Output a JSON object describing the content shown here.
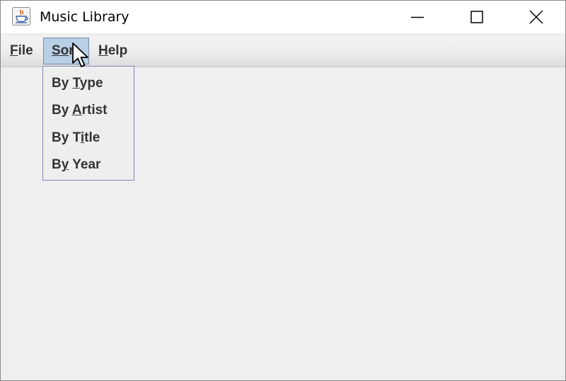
{
  "window": {
    "title": "Music Library",
    "icon": "java-cup-icon"
  },
  "window_controls": {
    "minimize": "minimize-icon",
    "maximize": "maximize-icon",
    "close": "close-icon"
  },
  "menubar": {
    "file": {
      "before": "",
      "mnemonic": "F",
      "after": "ile"
    },
    "sort": {
      "before": "",
      "mnemonic": "So",
      "after": "rt"
    },
    "help": {
      "before": "",
      "mnemonic": "H",
      "after": "elp"
    }
  },
  "sort_menu": {
    "items": [
      {
        "before": "By ",
        "mnemonic": "T",
        "after": "ype"
      },
      {
        "before": "By ",
        "mnemonic": "A",
        "after": "rtist"
      },
      {
        "before": "By T",
        "mnemonic": "i",
        "after": "tle"
      },
      {
        "before": "B",
        "mnemonic": "y",
        "after": " Year"
      }
    ]
  },
  "colors": {
    "menu_highlight": "#b8cfe5",
    "dropdown_border": "#8088b8",
    "content_bg": "#efefef"
  }
}
